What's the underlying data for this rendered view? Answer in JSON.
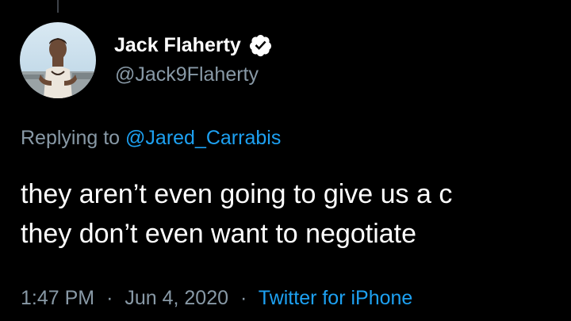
{
  "author": {
    "display_name": "Jack Flaherty",
    "handle": "@Jack9Flaherty",
    "verified": true,
    "avatar_icon": "profile-photo"
  },
  "reply": {
    "prefix": "Replying to",
    "to_handle": "@Jared_Carrabis"
  },
  "tweet": {
    "lines": [
      "they aren’t even going to give us a c",
      "they don’t even want to negotiate"
    ]
  },
  "meta": {
    "time": "1:47 PM",
    "separator": "·",
    "date": "Jun 4, 2020",
    "source": "Twitter for iPhone"
  },
  "colors": {
    "background": "#000000",
    "text": "#ffffff",
    "secondary": "#8899a6",
    "link": "#1da1f2"
  }
}
